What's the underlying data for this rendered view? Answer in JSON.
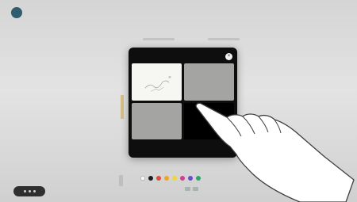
{
  "header": {
    "title": "",
    "subtitle": ""
  },
  "dialog": {
    "title": "",
    "subtitle": "",
    "footer": ""
  },
  "tiles": [
    {
      "kind": "whiteboard"
    },
    {
      "kind": "gray"
    },
    {
      "kind": "gray"
    },
    {
      "kind": "dark"
    }
  ],
  "toolbar": {
    "colors": [
      "#f5f5f5",
      "#1c1c1c",
      "#e14b3a",
      "#f0a528",
      "#f5d33d",
      "#d23f8f",
      "#6a4bd1",
      "#2aa66a"
    ]
  },
  "icons": {
    "close": "×",
    "avatar": "user-avatar",
    "hand": "pointing-hand"
  },
  "colors": {
    "dialog_bg": "#0e0e0e",
    "avatar_bg": "#2f5c6f",
    "accent_edge": "#d4b36a"
  }
}
